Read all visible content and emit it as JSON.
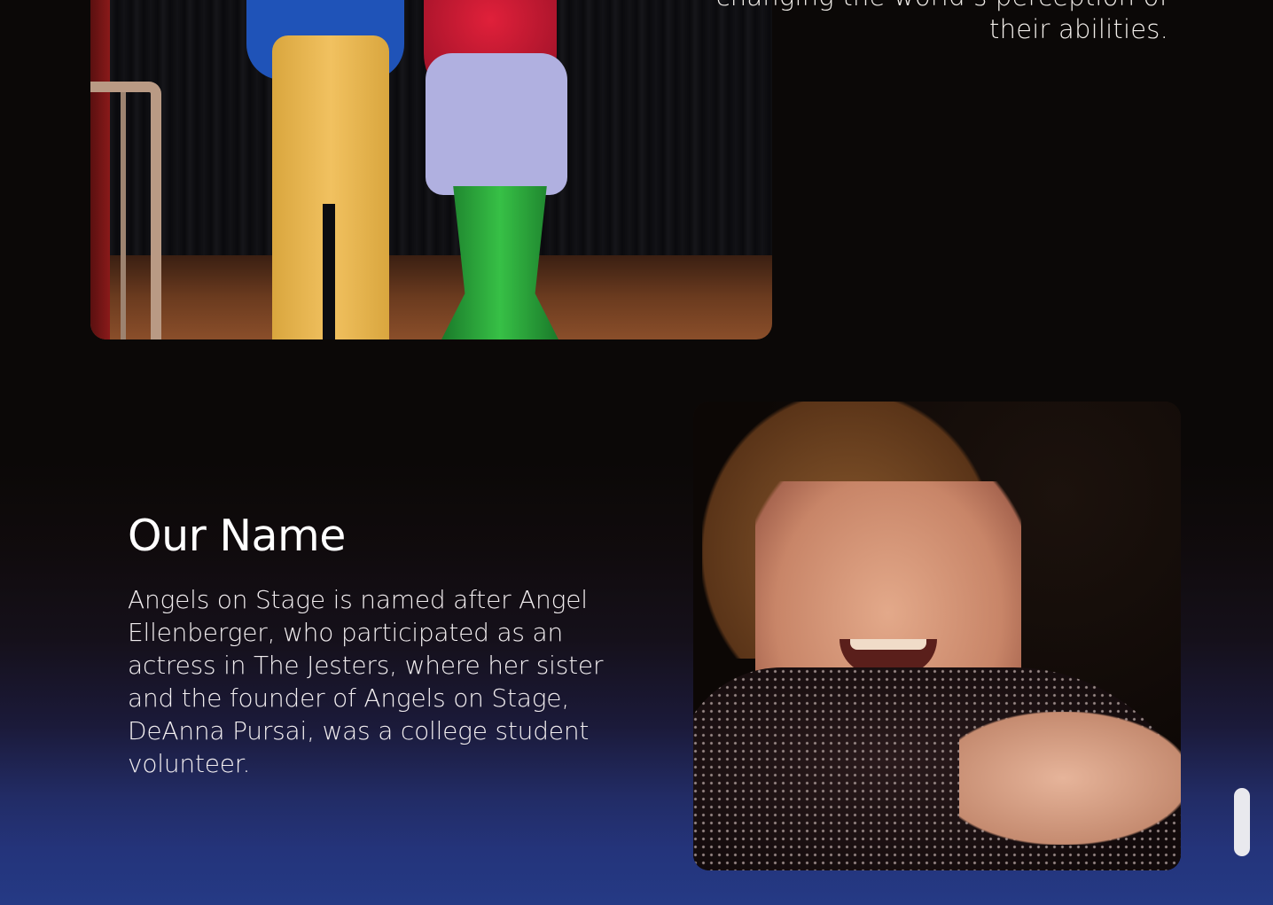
{
  "mission": {
    "text_line_1": "changing the world’s perception of",
    "text_line_2": "their abilities."
  },
  "images": {
    "stage_photo_alt": "Two performers in costume on stage",
    "portrait_photo_alt": "Angel Ellenberger smiling"
  },
  "our_name": {
    "heading": "Our Name",
    "body": "Angels on Stage is named after Angel Ellenberger, who participated as an actress in The Jesters, where her sister and the founder of Angels on Stage, DeAnna Pursai, was a college student volunteer."
  },
  "colors": {
    "background_dark": "#0b0807",
    "background_blue": "#253a85",
    "text": "#ffffff",
    "scrollbar": "#e9e9ee"
  }
}
